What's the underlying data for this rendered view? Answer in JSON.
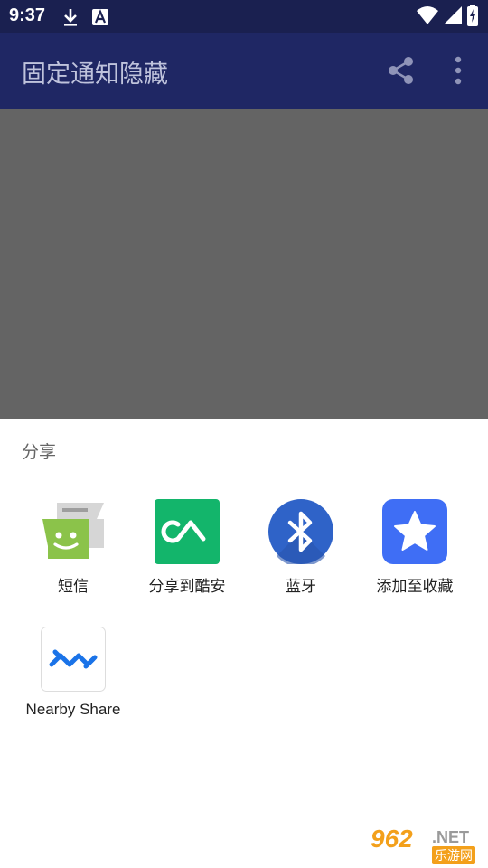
{
  "status_bar": {
    "time": "9:37",
    "icons": [
      "download-icon",
      "a-box-icon",
      "wifi-icon",
      "signal-icon",
      "battery-icon"
    ]
  },
  "app_bar": {
    "title": "固定通知隐藏",
    "actions": [
      "share-icon",
      "more-vert-icon"
    ]
  },
  "share_sheet": {
    "title": "分享",
    "targets": [
      {
        "label": "短信",
        "icon": "messages-icon",
        "color": "#8bc34a"
      },
      {
        "label": "分享到酷安",
        "icon": "coolapk-icon",
        "color": "#13b56b"
      },
      {
        "label": "蓝牙",
        "icon": "bluetooth-icon",
        "color": "#2f63c8"
      },
      {
        "label": "添加至收藏",
        "icon": "star-icon",
        "color": "#3f6ef5"
      },
      {
        "label": "Nearby Share",
        "icon": "nearby-share-icon",
        "color": "#1a73e8"
      }
    ]
  },
  "watermark": {
    "number": "962",
    "suffix": ".NET",
    "site": "乐游网"
  },
  "colors": {
    "app_bar": "#1f2764",
    "scrim": "#646464",
    "sheet": "#ffffff"
  }
}
